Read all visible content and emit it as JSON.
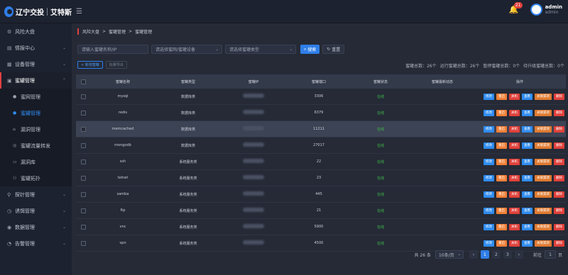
{
  "header": {
    "logo_text": "辽宁交投",
    "brand_text": "艾特斯",
    "notification_count": "21",
    "user_name": "admin",
    "user_sub": "admin"
  },
  "sidebar": {
    "items": [
      {
        "label": "风险大盘",
        "icon": "dashboard-icon"
      },
      {
        "label": "情报中心",
        "icon": "intel-icon",
        "chevron": "⌄"
      },
      {
        "label": "设备管理",
        "icon": "device-icon",
        "chevron": "⌄"
      },
      {
        "label": "蜜罐管理",
        "icon": "honeypot-icon",
        "chevron": "⌃"
      },
      {
        "label": "探针管理",
        "icon": "probe-icon",
        "chevron": "⌄"
      },
      {
        "label": "诱饵管理",
        "icon": "bait-icon",
        "chevron": "⌄"
      },
      {
        "label": "数据管理",
        "icon": "data-icon",
        "chevron": "⌄"
      },
      {
        "label": "告警管理",
        "icon": "alarm-icon",
        "chevron": "⌄"
      }
    ],
    "sub_items": [
      {
        "label": "蜜网管理"
      },
      {
        "label": "蜜罐管理"
      },
      {
        "label": "漏洞管理"
      },
      {
        "label": "蜜罐流量转发"
      },
      {
        "label": "漏洞库"
      },
      {
        "label": "蜜罐拓扑"
      }
    ]
  },
  "breadcrumb": [
    "风险大盘",
    ">",
    "蜜罐管理",
    ">",
    "蜜罐管理"
  ],
  "filters": {
    "name_placeholder": "请输入蜜罐名称/IP",
    "net_placeholder": "请选择蜜网/蜜罐设备",
    "type_placeholder": "请选择蜜罐类型",
    "search_label": "搜索",
    "reset_label": "重置"
  },
  "actions": {
    "add_label": "+ 新增蜜罐",
    "export_label": "批量导出"
  },
  "stats": {
    "total": "蜜罐总数：26个",
    "running": "运行蜜罐总数：26个",
    "paused": "暂停蜜罐总数：0个",
    "pending": "待升级蜜罐总数：0个"
  },
  "table": {
    "headers": [
      "蜜罐名称",
      "蜜罐类型",
      "蜜罐IP",
      "蜜罐端口",
      "蜜罐状态",
      "蜜罐最新动态",
      "操作"
    ],
    "buttons": {
      "edit": "修改",
      "restart": "重启",
      "close": "关机",
      "view": "查看",
      "link": "关联漏洞",
      "del": "删除"
    },
    "rows": [
      {
        "name": "mysql",
        "type": "数据库类",
        "port": "3306",
        "status": "在线"
      },
      {
        "name": "redis",
        "type": "数据库类",
        "port": "6379",
        "status": "在线"
      },
      {
        "name": "memcached",
        "type": "数据库类",
        "port": "11211",
        "status": "在线"
      },
      {
        "name": "mongodb",
        "type": "数据库类",
        "port": "27017",
        "status": "在线"
      },
      {
        "name": "ssh",
        "type": "系统服务类",
        "port": "22",
        "status": "在线"
      },
      {
        "name": "telnet",
        "type": "系统服务类",
        "port": "23",
        "status": "在线"
      },
      {
        "name": "samba",
        "type": "系统服务类",
        "port": "445",
        "status": "在线"
      },
      {
        "name": "ftp",
        "type": "系统服务类",
        "port": "21",
        "status": "在线"
      },
      {
        "name": "vnc",
        "type": "系统服务类",
        "port": "5900",
        "status": "在线"
      },
      {
        "name": "vpn",
        "type": "系统服务类",
        "port": "4500",
        "status": "在线"
      }
    ]
  },
  "pager": {
    "total": "共 26 条",
    "size": "10条/页",
    "prev": "‹",
    "pages": [
      "1",
      "2",
      "3"
    ],
    "next": "›",
    "goto": "前往",
    "goto_value": "1",
    "goto_unit": "页"
  }
}
